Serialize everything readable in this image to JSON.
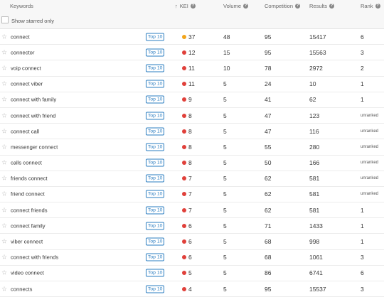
{
  "header": {
    "keywords": "Keywords",
    "kei": "KEI",
    "volume": "Volume",
    "competition": "Competition",
    "results": "Results",
    "rank": "Rank"
  },
  "filter": {
    "label": "Show starred only"
  },
  "colors": {
    "red": "#e0403a",
    "orange": "#f2a51a",
    "link": "#2a7cc0"
  },
  "rows": [
    {
      "keyword": "connect",
      "top": "Top 10",
      "kei": "37",
      "kei_color": "orange",
      "volume": "48",
      "competition": "95",
      "results": "15417",
      "rank": "6"
    },
    {
      "keyword": "connector",
      "top": "Top 10",
      "kei": "12",
      "kei_color": "red",
      "volume": "15",
      "competition": "95",
      "results": "15563",
      "rank": "3"
    },
    {
      "keyword": "voip connect",
      "top": "Top 10",
      "kei": "11",
      "kei_color": "red",
      "volume": "10",
      "competition": "78",
      "results": "2972",
      "rank": "2"
    },
    {
      "keyword": "connect viber",
      "top": "Top 10",
      "kei": "11",
      "kei_color": "red",
      "volume": "5",
      "competition": "24",
      "results": "10",
      "rank": "1"
    },
    {
      "keyword": "connect with family",
      "top": "Top 10",
      "kei": "9",
      "kei_color": "red",
      "volume": "5",
      "competition": "41",
      "results": "62",
      "rank": "1"
    },
    {
      "keyword": "connect with friend",
      "top": "Top 10",
      "kei": "8",
      "kei_color": "red",
      "volume": "5",
      "competition": "47",
      "results": "123",
      "rank": "unranked"
    },
    {
      "keyword": "connect call",
      "top": "Top 10",
      "kei": "8",
      "kei_color": "red",
      "volume": "5",
      "competition": "47",
      "results": "116",
      "rank": "unranked"
    },
    {
      "keyword": "messenger connect",
      "top": "Top 10",
      "kei": "8",
      "kei_color": "red",
      "volume": "5",
      "competition": "55",
      "results": "280",
      "rank": "unranked"
    },
    {
      "keyword": "calls connect",
      "top": "Top 10",
      "kei": "8",
      "kei_color": "red",
      "volume": "5",
      "competition": "50",
      "results": "166",
      "rank": "unranked"
    },
    {
      "keyword": "friends connect",
      "top": "Top 10",
      "kei": "7",
      "kei_color": "red",
      "volume": "5",
      "competition": "62",
      "results": "581",
      "rank": "unranked"
    },
    {
      "keyword": "friend connect",
      "top": "Top 10",
      "kei": "7",
      "kei_color": "red",
      "volume": "5",
      "competition": "62",
      "results": "581",
      "rank": "unranked"
    },
    {
      "keyword": "connect friends",
      "top": "Top 10",
      "kei": "7",
      "kei_color": "red",
      "volume": "5",
      "competition": "62",
      "results": "581",
      "rank": "1"
    },
    {
      "keyword": "connect family",
      "top": "Top 10",
      "kei": "6",
      "kei_color": "red",
      "volume": "5",
      "competition": "71",
      "results": "1433",
      "rank": "1"
    },
    {
      "keyword": "viber connect",
      "top": "Top 10",
      "kei": "6",
      "kei_color": "red",
      "volume": "5",
      "competition": "68",
      "results": "998",
      "rank": "1"
    },
    {
      "keyword": "connect with friends",
      "top": "Top 10",
      "kei": "6",
      "kei_color": "red",
      "volume": "5",
      "competition": "68",
      "results": "1061",
      "rank": "3"
    },
    {
      "keyword": "video connect",
      "top": "Top 10",
      "kei": "5",
      "kei_color": "red",
      "volume": "5",
      "competition": "86",
      "results": "6741",
      "rank": "6"
    },
    {
      "keyword": "connects",
      "top": "Top 10",
      "kei": "4",
      "kei_color": "red",
      "volume": "5",
      "competition": "95",
      "results": "15537",
      "rank": "3"
    }
  ]
}
